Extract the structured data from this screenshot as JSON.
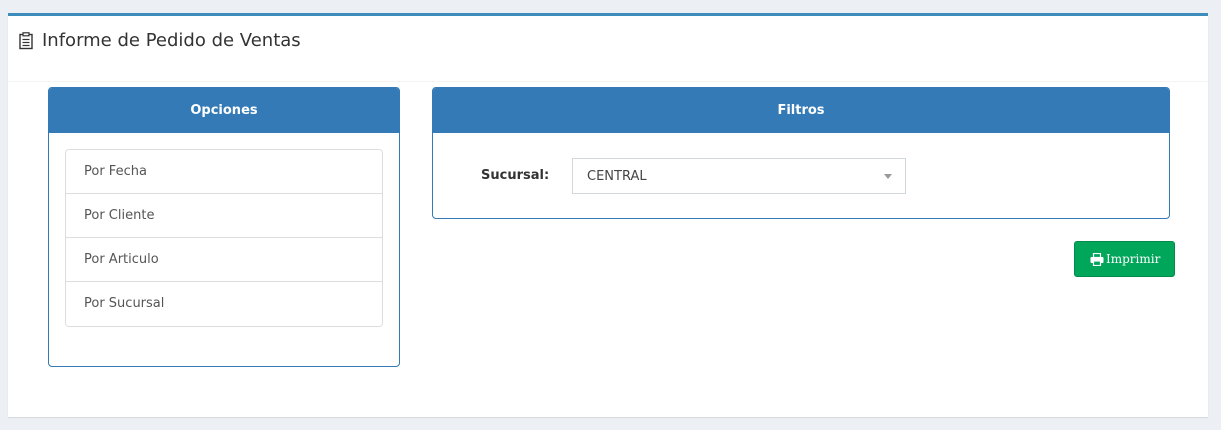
{
  "header": {
    "title": "Informe de Pedido de Ventas",
    "icon": "clipboard-icon"
  },
  "opciones": {
    "heading": "Opciones",
    "items": [
      {
        "label": "Por Fecha"
      },
      {
        "label": "Por Cliente"
      },
      {
        "label": "Por Articulo"
      },
      {
        "label": "Por Sucursal"
      }
    ]
  },
  "filtros": {
    "heading": "Filtros",
    "sucursal_label": "Sucursal:",
    "sucursal_value": "CENTRAL"
  },
  "actions": {
    "print_label": "Imprimir",
    "print_icon": "printer-icon"
  },
  "colors": {
    "primary": "#337ab7",
    "accent_top": "#3c8dbc",
    "success": "#00a65a",
    "background": "#ecf0f5"
  }
}
